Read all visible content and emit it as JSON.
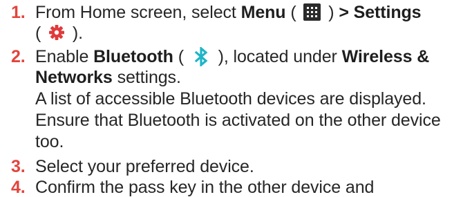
{
  "colors": {
    "step_number": "#e2443c",
    "body_text": "#262626",
    "bluetooth_icon": "#1fb5c7",
    "settings_icon": "#e03a3a",
    "menu_icon_bg": "#2b2b2b"
  },
  "icons": {
    "menu": "grid-menu-icon",
    "settings": "gear-icon",
    "bluetooth": "bluetooth-icon"
  },
  "steps": [
    {
      "number": "1.",
      "line1_prefix": "From Home screen, select ",
      "line1_bold1": "Menu",
      "line1_paren_open": " ( ",
      "line1_paren_close": " ) ",
      "line1_bold2": "> Settings",
      "line2_paren_open": "( ",
      "line2_paren_close": " )."
    },
    {
      "number": "2.",
      "line1_prefix": "Enable ",
      "line1_bold1": "Bluetooth",
      "line1_paren_open": " ( ",
      "line1_mid": " ), located under ",
      "line1_bold2": "Wireless &",
      "line2_bold": "Networks",
      "line2_suffix": " settings.",
      "line3": "A list of accessible Bluetooth devices are displayed.",
      "line4": "Ensure that Bluetooth is activated on the other device",
      "line5": "too."
    },
    {
      "number": "3.",
      "text": "Select your preferred device."
    },
    {
      "number": "4.",
      "text": "Confirm the pass key in the other device and"
    }
  ]
}
